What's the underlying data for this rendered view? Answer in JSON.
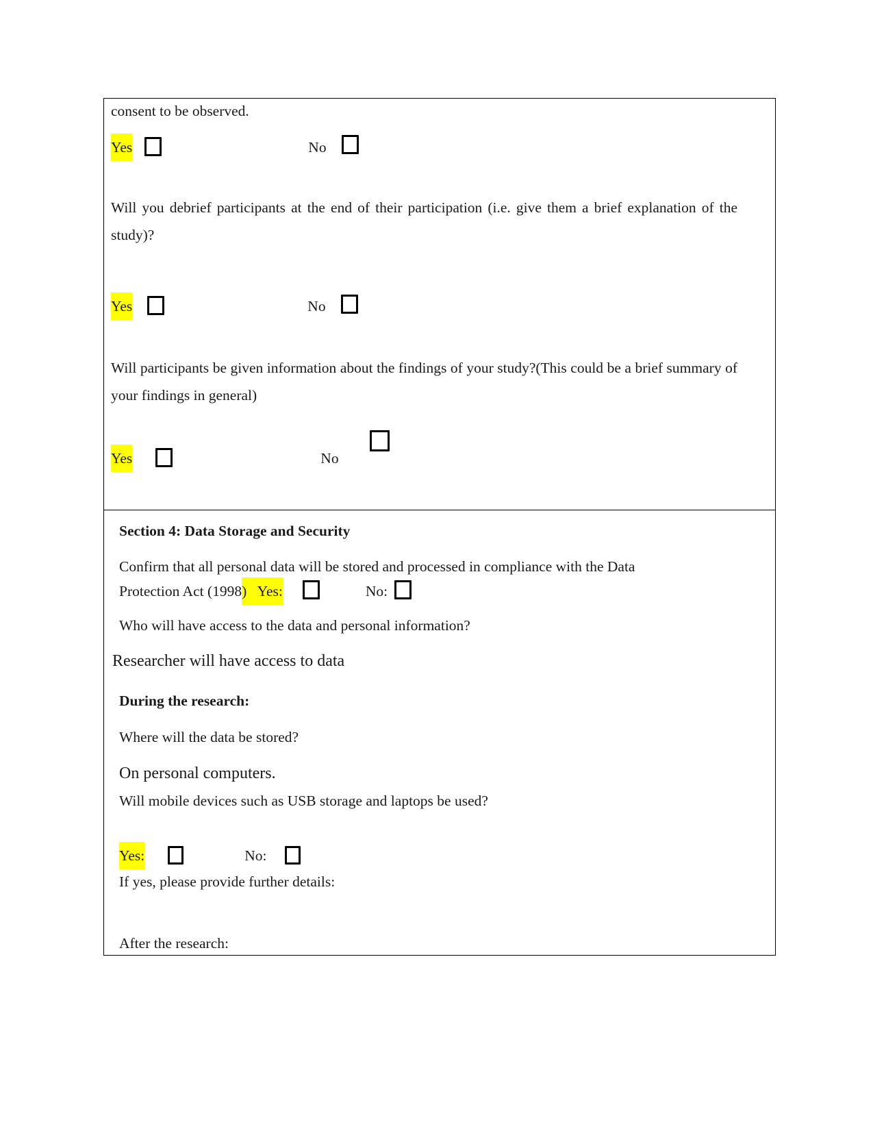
{
  "document": {
    "type": "research-ethics-form",
    "highlight_color": "#ffff00",
    "text_color": "#1a1a1a"
  },
  "section_a": {
    "line_consent": "consent to be observed.",
    "q1_yes_label": "Yes",
    "q1_no_label": "No",
    "q2_text": "Will you debrief participants at the end of their participation (i.e. give them a brief explanation of the study)?",
    "q2_yes_label": "Yes",
    "q2_no_label": "No",
    "q3_text": "Will participants be given information about the findings of your study?(This could be a brief summary of your findings in general)",
    "q3_yes_label": "Yes",
    "q3_no_label": "No"
  },
  "section_4": {
    "heading": "Section 4: Data Storage and Security",
    "confirm_line1": "Confirm that all personal data will be stored and processed in compliance with the Data",
    "confirm_line2_prefix": "Protection Act (1998",
    "confirm_line2_highlight": ")   Yes:",
    "confirm_no_label": "No:",
    "who_access_question": "Who will have access to the data and personal information?",
    "who_access_answer": "Researcher will have access to data",
    "during_research_heading": "During the research:",
    "where_stored_question": "Where will the data be stored?",
    "where_stored_answer": "On personal computers.",
    "mobile_devices_question": "Will mobile devices such as USB storage and laptops be used?",
    "mobile_yes_label": "Yes:",
    "mobile_no_label": "No:",
    "further_details_prompt": "If yes, please provide further details:",
    "after_research_heading": "After the research:"
  }
}
